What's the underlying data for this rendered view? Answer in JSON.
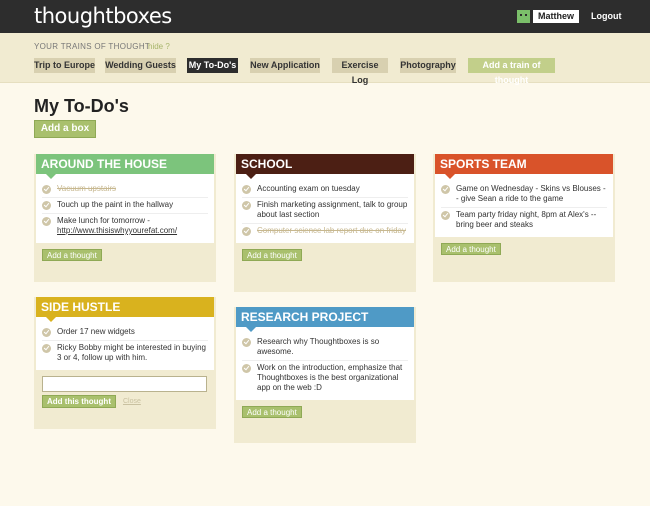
{
  "header": {
    "logo": "thoughtboxes",
    "username": "Matthew",
    "logout": "Logout"
  },
  "trains": {
    "label": "YOUR TRAINS OF THOUGHT",
    "hide": "hide ?",
    "tabs": [
      {
        "label": "Trip to Europe"
      },
      {
        "label": "Wedding Guests"
      },
      {
        "label": "My To-Do's"
      },
      {
        "label": "New Application"
      },
      {
        "label": "Exercise Log"
      },
      {
        "label": "Photography"
      }
    ],
    "add_label": "Add a train of thought",
    "active_index": 2
  },
  "page": {
    "title": "My To-Do's",
    "add_box": "Add a box"
  },
  "boxes": [
    {
      "title": "AROUND THE HOUSE",
      "color": "#7cc47c",
      "items": [
        {
          "text": "Vacuum upstairs",
          "done": true
        },
        {
          "text": "Touch up the paint in the hallway",
          "done": false
        },
        {
          "text": "Make lunch for tomorrow -",
          "link": "http://www.thisiswhyyourefat.com/",
          "done": false
        }
      ],
      "add_thought": "Add a thought"
    },
    {
      "title": "SCHOOL",
      "color": "#4c1f14",
      "items": [
        {
          "text": "Accounting exam on tuesday",
          "done": false
        },
        {
          "text": "Finish marketing assignment, talk to group about last section",
          "done": false
        },
        {
          "text": "Computer science lab report due on friday",
          "done": true
        }
      ],
      "add_thought": "Add a thought"
    },
    {
      "title": "SPORTS TEAM",
      "color": "#d9532a",
      "items": [
        {
          "text": "Game on Wednesday - Skins vs Blouses -- give Sean a ride to the game",
          "done": false
        },
        {
          "text": "Team party friday night, 8pm at Alex's -- bring beer and steaks",
          "done": false
        }
      ],
      "add_thought": "Add a thought"
    },
    {
      "title": "SIDE HUSTLE",
      "color": "#d9b21e",
      "items": [
        {
          "text": "Order 17 new widgets",
          "done": false
        },
        {
          "text": "Ricky Bobby might be interested in buying 3 or 4, follow up with him.",
          "done": false
        }
      ],
      "input_value": "",
      "add_this": "Add this thought",
      "close": "Close"
    },
    {
      "title": "RESEARCH PROJECT",
      "color": "#4f9ac6",
      "items": [
        {
          "text": "Research why Thoughtboxes is so awesome.",
          "done": false
        },
        {
          "text": "Work on the introduction, emphasize that Thoughtboxes is the best organizational app on the web :D",
          "done": false
        }
      ],
      "add_thought": "Add a thought"
    }
  ]
}
